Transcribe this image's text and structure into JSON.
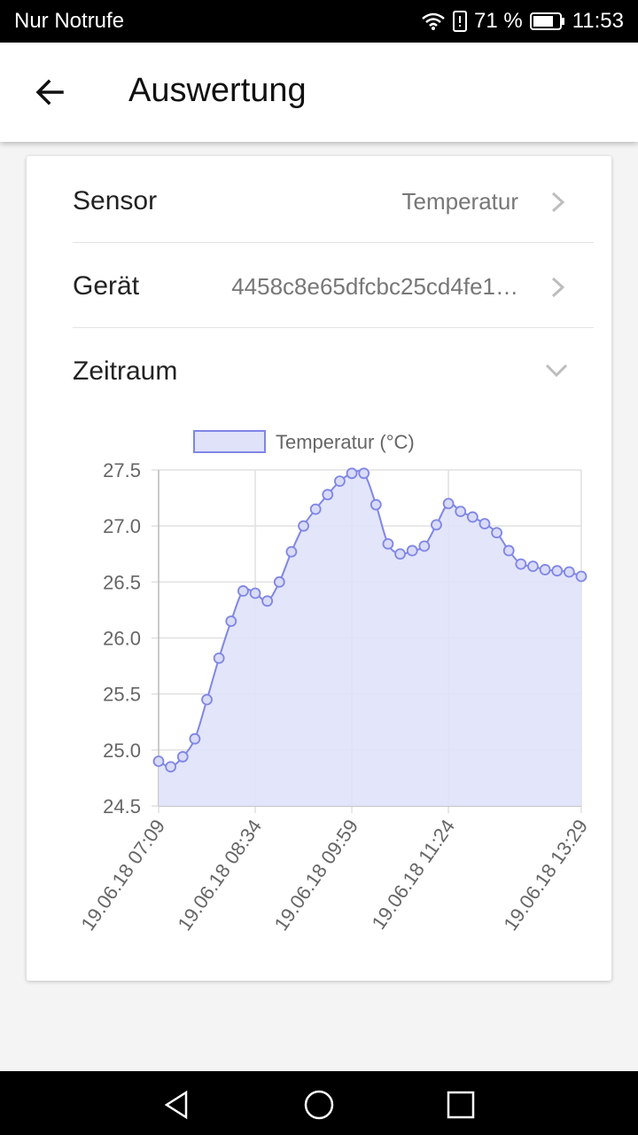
{
  "status_bar": {
    "carrier": "Nur Notrufe",
    "battery": "71 %",
    "time": "11:53"
  },
  "app_bar": {
    "title": "Auswertung",
    "back_icon": "arrow-left-icon"
  },
  "settings": {
    "sensor_label": "Sensor",
    "sensor_value": "Temperatur",
    "device_label": "Gerät",
    "device_value": "4458c8e65dfcbc25cd4fe1…",
    "period_label": "Zeitraum"
  },
  "chart_data": {
    "type": "area",
    "legend": "Temperatur (°C)",
    "color_line": "#7f86e6",
    "color_fill": "#e0e2fa",
    "ylim": [
      24.5,
      27.5
    ],
    "yticks": [
      "27.5",
      "27.0",
      "26.5",
      "26.0",
      "25.5",
      "25.0",
      "24.5"
    ],
    "xticks": [
      "19.06.18 07:09",
      "19.06.18 08:34",
      "19.06.18 09:59",
      "19.06.18 11:24",
      "19.06.18 13:29"
    ],
    "values": [
      24.9,
      24.85,
      24.94,
      25.1,
      25.45,
      25.82,
      26.15,
      26.42,
      26.4,
      26.33,
      26.5,
      26.77,
      27.0,
      27.15,
      27.28,
      27.4,
      27.47,
      27.47,
      27.19,
      26.84,
      26.75,
      26.78,
      26.82,
      27.01,
      27.2,
      27.13,
      27.08,
      27.02,
      26.94,
      26.78,
      26.66,
      26.64,
      26.61,
      26.6,
      26.59,
      26.55
    ]
  },
  "nav_bar": {
    "back_icon": "triangle-back-icon",
    "home_icon": "circle-home-icon",
    "recent_icon": "square-recent-icon"
  }
}
